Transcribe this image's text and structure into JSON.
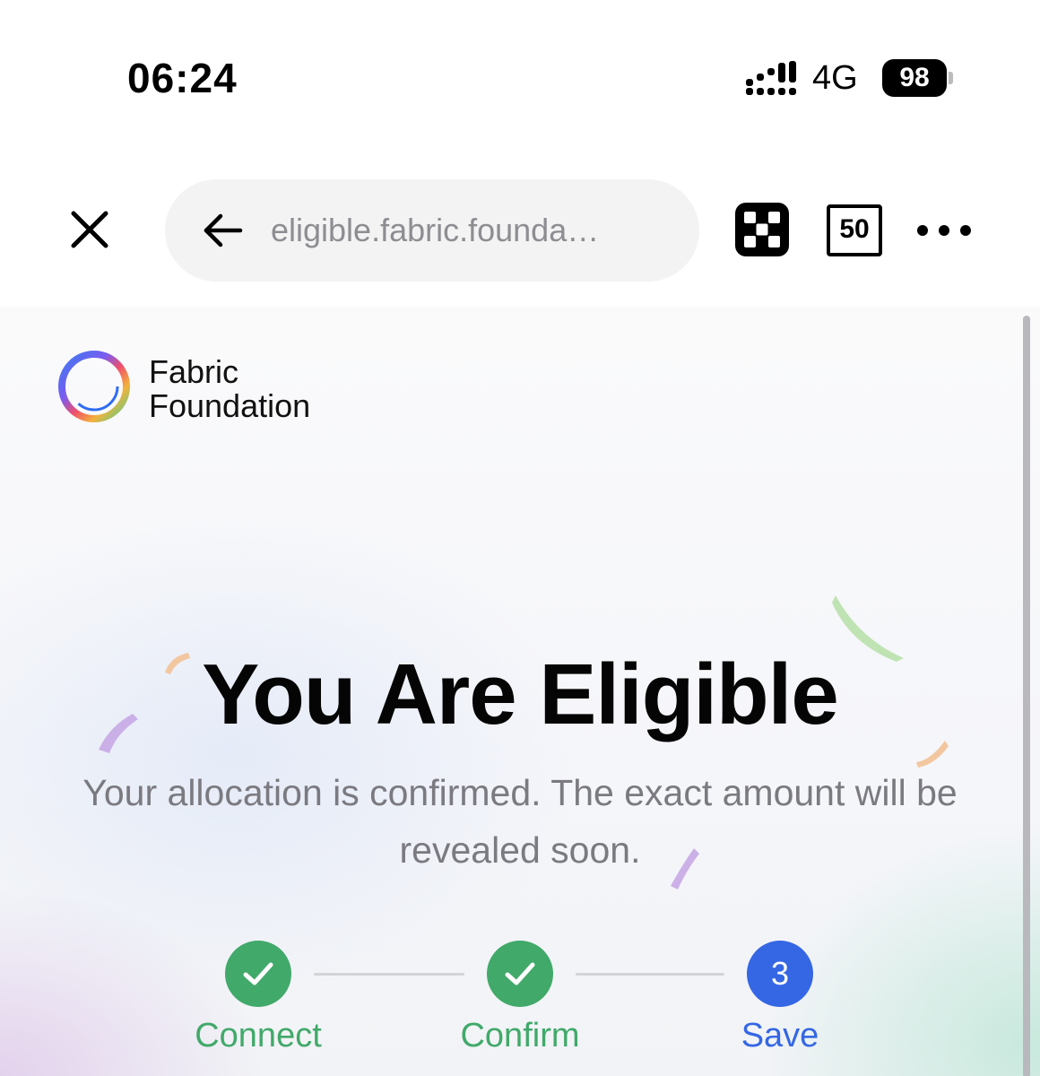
{
  "status_bar": {
    "time": "06:24",
    "network": "4G",
    "battery": "98",
    "signal_icon": "signal-bars-icon"
  },
  "toolbar": {
    "close_icon": "close-icon",
    "back_icon": "back-arrow-icon",
    "url": "eligible.fabric.founda…",
    "qr_icon": "qr-scan-icon",
    "tabs_count": "50",
    "more_icon": "more-dots-icon"
  },
  "page": {
    "brand": {
      "line1": "Fabric",
      "line2": "Foundation",
      "logo_icon": "fabric-ring-logo"
    },
    "headline": "You Are Eligible",
    "subtitle": "Your allocation is confirmed. The exact amount will be revealed soon.",
    "steps": [
      {
        "label": "Connect",
        "status": "done"
      },
      {
        "label": "Confirm",
        "status": "done"
      },
      {
        "label": "Save",
        "status": "active",
        "number": "3"
      }
    ]
  },
  "colors": {
    "step_done": "#41a96a",
    "step_active": "#3567e4",
    "url_text": "#8d8d92",
    "subtitle_text": "#7a7a80"
  }
}
